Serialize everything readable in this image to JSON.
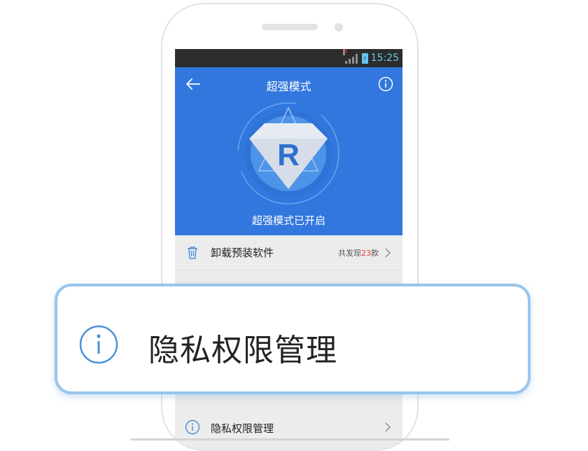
{
  "status_bar": {
    "time": "15:25"
  },
  "header": {
    "title": "超强模式",
    "logo_letter": "R",
    "status_text": "超强模式已开启"
  },
  "list": {
    "items": [
      {
        "label": "卸载预装软件",
        "count_prefix": "共发现",
        "count_number": "23",
        "count_suffix": "款"
      }
    ],
    "bottom_item": {
      "label": "隐私权限管理"
    }
  },
  "callout": {
    "label": "隐私权限管理"
  },
  "colors": {
    "header_blue": "#3277de",
    "accent_blue": "#4a90d9",
    "callout_border": "#96c6ee",
    "count_red": "#e53935",
    "status_time": "#64c6ee"
  },
  "icons": {
    "back": "arrow-left-icon",
    "info": "info-icon",
    "trash": "trash-icon",
    "chevron": "chevron-right-icon",
    "logo": "diamond-r-logo-icon"
  }
}
